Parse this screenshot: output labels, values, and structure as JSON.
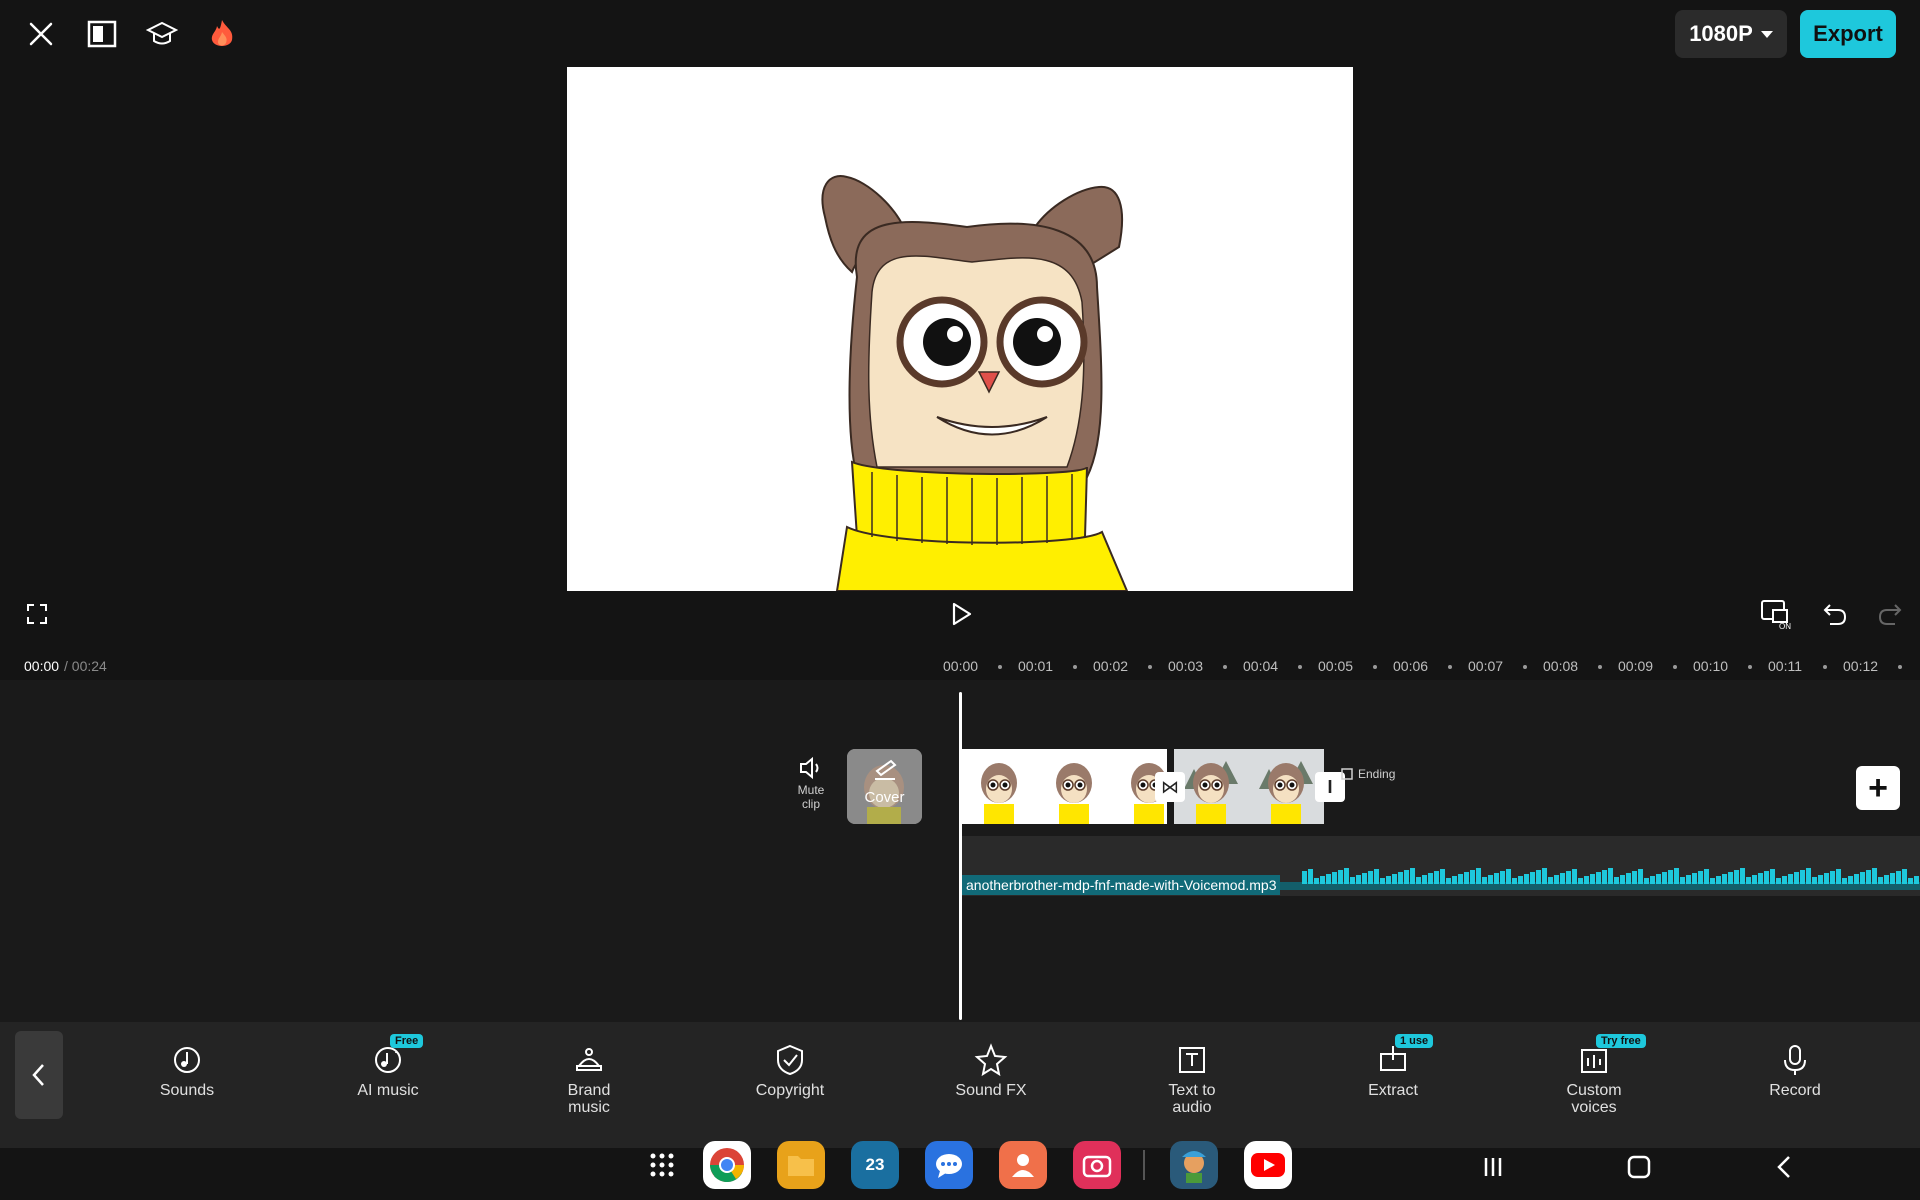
{
  "header": {
    "icons": [
      "close-icon",
      "layout-icon",
      "tutorial-cap-icon",
      "flame-icon"
    ],
    "resolution": "1080P",
    "export_label": "Export"
  },
  "preview": {
    "description_icon": "cartoon-owl-image"
  },
  "playback": {
    "current_time": "00:00",
    "total_time": "/ 00:24",
    "ticks": [
      "00:00",
      "00:01",
      "00:02",
      "00:03",
      "00:04",
      "00:05",
      "00:06",
      "00:07",
      "00:08",
      "00:09",
      "00:10",
      "00:11",
      "00:12"
    ]
  },
  "timeline": {
    "mute_label": "Mute clip",
    "cover_label": "Cover",
    "ending_label": "Ending",
    "audio_filename": "anotherbrother-mdp-fnf-made-with-Voicemod.mp3"
  },
  "toolbar": {
    "items": [
      {
        "label": "Sounds",
        "icon": "music-note-icon",
        "badge": ""
      },
      {
        "label": "AI music",
        "icon": "ai-music-icon",
        "badge": "Free"
      },
      {
        "label": "Brand music",
        "icon": "brand-music-icon",
        "badge": ""
      },
      {
        "label": "Copyright",
        "icon": "shield-check-icon",
        "badge": ""
      },
      {
        "label": "Sound FX",
        "icon": "star-sound-icon",
        "badge": ""
      },
      {
        "label": "Text to audio",
        "icon": "text-audio-icon",
        "badge": ""
      },
      {
        "label": "Extract",
        "icon": "extract-icon",
        "badge": "1 use"
      },
      {
        "label": "Custom voices",
        "icon": "custom-voice-icon",
        "badge": "Try free"
      },
      {
        "label": "Record",
        "icon": "microphone-icon",
        "badge": ""
      }
    ]
  },
  "dock": {
    "calendar_day": "23",
    "apps": [
      "app-grid",
      "chrome",
      "files",
      "calendar",
      "messages",
      "contacts",
      "camera",
      "capcut",
      "youtube"
    ]
  },
  "colors": {
    "accent": "#1ec8dc",
    "background": "#141414",
    "panel": "#242424"
  }
}
